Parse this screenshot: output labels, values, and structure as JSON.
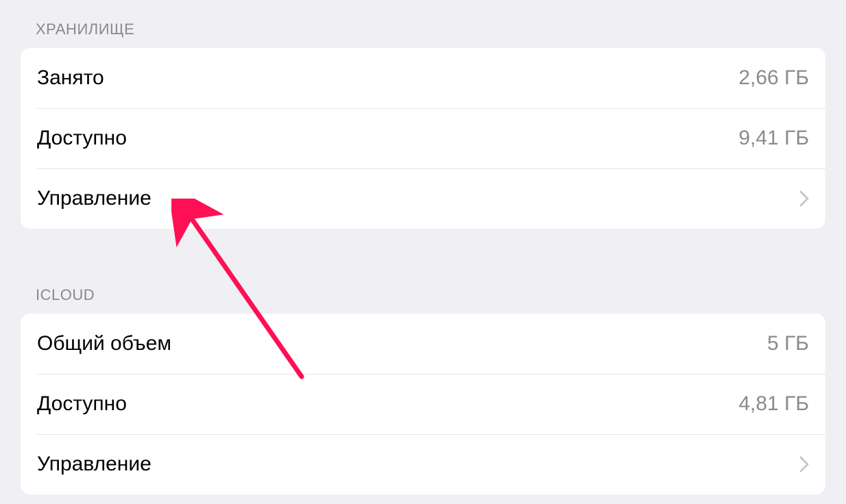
{
  "sections": {
    "storage": {
      "header": "Хранилище",
      "rows": {
        "used": {
          "label": "Занято",
          "value": "2,66 ГБ"
        },
        "available": {
          "label": "Доступно",
          "value": "9,41 ГБ"
        },
        "manage": {
          "label": "Управление"
        }
      }
    },
    "icloud": {
      "header": "iCloud",
      "rows": {
        "total": {
          "label": "Общий объем",
          "value": "5 ГБ"
        },
        "available": {
          "label": "Доступно",
          "value": "4,81 ГБ"
        },
        "manage": {
          "label": "Управление"
        }
      }
    }
  },
  "annotation": {
    "color": "#ff1054"
  }
}
